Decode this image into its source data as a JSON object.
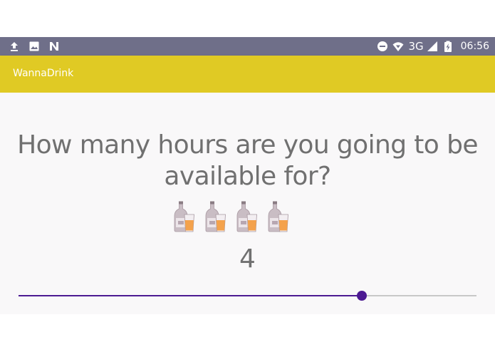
{
  "status_bar": {
    "background": "#6f6f89",
    "left_icons": [
      "upload-icon",
      "image-icon",
      "n-notification-icon"
    ],
    "right_icons": [
      "do-not-disturb-icon",
      "wifi-icon",
      "cell-signal-icon",
      "battery-charging-icon"
    ],
    "network": "3G",
    "time": "06:56"
  },
  "app_bar": {
    "title": "WannaDrink",
    "color": "#e0ca24"
  },
  "main": {
    "question": "How many hours are you going to be available for?",
    "value_display": "4",
    "drink_icon_count": 4,
    "drink_icon": "bottle-and-glass-icon"
  },
  "slider": {
    "value_fraction": 0.75,
    "accent": "#4c1a92"
  }
}
